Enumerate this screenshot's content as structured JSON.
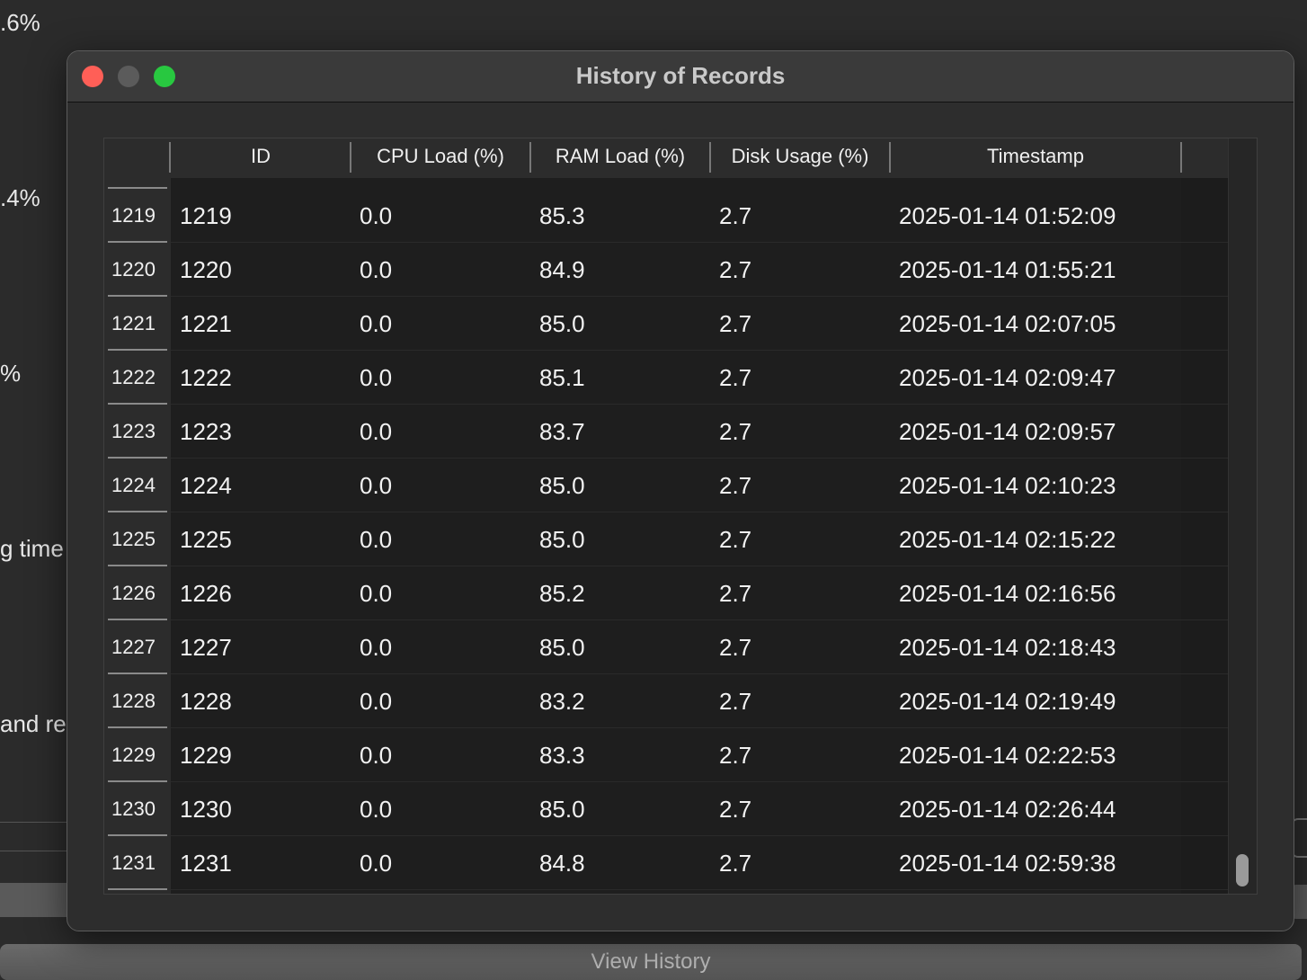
{
  "background": {
    "labels": [
      ".6%",
      ".4%",
      "%",
      "g time",
      "and re"
    ],
    "view_history_button": "View History"
  },
  "window": {
    "title": "History of Records"
  },
  "table": {
    "columns": [
      "ID",
      "CPU Load (%)",
      "RAM Load (%)",
      "Disk Usage (%)",
      "Timestamp"
    ],
    "rows": [
      {
        "row_header": "1219",
        "cells": [
          "1219",
          "0.0",
          "85.3",
          "2.7",
          "2025-01-14 01:52:09"
        ]
      },
      {
        "row_header": "1220",
        "cells": [
          "1220",
          "0.0",
          "84.9",
          "2.7",
          "2025-01-14 01:55:21"
        ]
      },
      {
        "row_header": "1221",
        "cells": [
          "1221",
          "0.0",
          "85.0",
          "2.7",
          "2025-01-14 02:07:05"
        ]
      },
      {
        "row_header": "1222",
        "cells": [
          "1222",
          "0.0",
          "85.1",
          "2.7",
          "2025-01-14 02:09:47"
        ]
      },
      {
        "row_header": "1223",
        "cells": [
          "1223",
          "0.0",
          "83.7",
          "2.7",
          "2025-01-14 02:09:57"
        ]
      },
      {
        "row_header": "1224",
        "cells": [
          "1224",
          "0.0",
          "85.0",
          "2.7",
          "2025-01-14 02:10:23"
        ]
      },
      {
        "row_header": "1225",
        "cells": [
          "1225",
          "0.0",
          "85.0",
          "2.7",
          "2025-01-14 02:15:22"
        ]
      },
      {
        "row_header": "1226",
        "cells": [
          "1226",
          "0.0",
          "85.2",
          "2.7",
          "2025-01-14 02:16:56"
        ]
      },
      {
        "row_header": "1227",
        "cells": [
          "1227",
          "0.0",
          "85.0",
          "2.7",
          "2025-01-14 02:18:43"
        ]
      },
      {
        "row_header": "1228",
        "cells": [
          "1228",
          "0.0",
          "83.2",
          "2.7",
          "2025-01-14 02:19:49"
        ]
      },
      {
        "row_header": "1229",
        "cells": [
          "1229",
          "0.0",
          "83.3",
          "2.7",
          "2025-01-14 02:22:53"
        ]
      },
      {
        "row_header": "1230",
        "cells": [
          "1230",
          "0.0",
          "85.0",
          "2.7",
          "2025-01-14 02:26:44"
        ]
      },
      {
        "row_header": "1231",
        "cells": [
          "1231",
          "0.0",
          "84.8",
          "2.7",
          "2025-01-14 02:59:38"
        ]
      }
    ]
  },
  "colors": {
    "close": "#ff5f57",
    "minimize": "#5b5b5b",
    "maximize": "#28c840"
  }
}
